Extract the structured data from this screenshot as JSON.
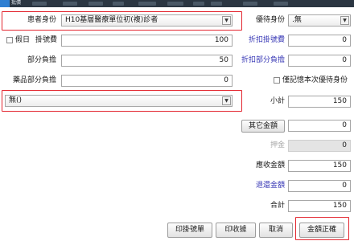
{
  "window": {
    "title": "批價"
  },
  "form": {
    "patient_type_label": "患者身份",
    "patient_type_value": "H10基層醫療單位初(複)診者",
    "preferential_label": "優待身份",
    "preferential_value": ".無",
    "holiday_label": "假日",
    "reg_fee_label": "掛號費",
    "reg_fee_value": "100",
    "discount_reg_label": "折扣掛號費",
    "discount_reg_value": "0",
    "copay_label": "部分負擔",
    "copay_value": "50",
    "discount_copay_label": "折扣部分負擔",
    "discount_copay_value": "0",
    "drug_copay_label": "藥品部分負擔",
    "drug_copay_value": "0",
    "only_remember_label": "僅記憶本次優待身份",
    "other_select_value": "無()",
    "subtotal_label": "小計",
    "subtotal_value": "150",
    "other_amount_label": "其它金額",
    "other_amount_value": "0",
    "deposit_label": "押金",
    "deposit_value": "0",
    "receivable_label": "應收金額",
    "receivable_value": "150",
    "refund_label": "退還金額",
    "refund_value": "0",
    "total_label": "合計",
    "total_value": "150"
  },
  "buttons": {
    "print_reg": "印掛號單",
    "print_receipt": "印收據",
    "cancel": "取消",
    "confirm": "金額正確"
  },
  "colors": {
    "highlight": "#e3262f",
    "link_label": "#3434b4"
  }
}
